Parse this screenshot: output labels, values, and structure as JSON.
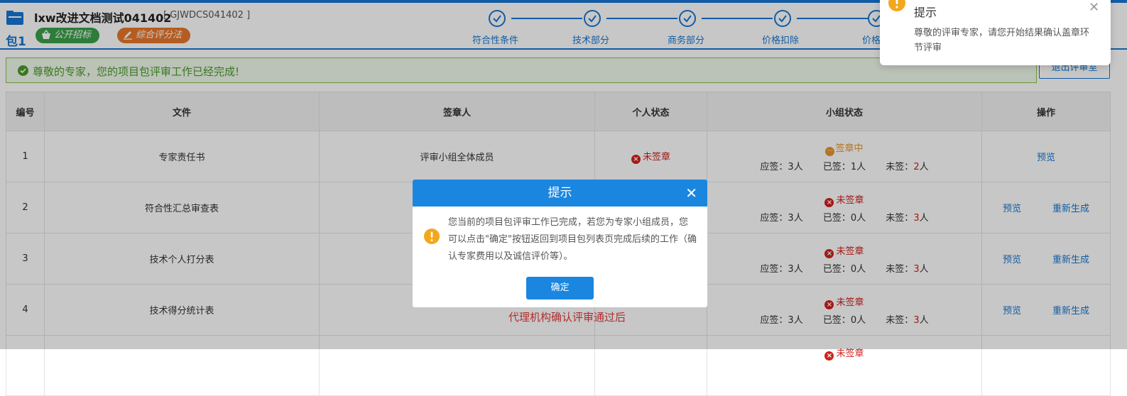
{
  "header": {
    "package_label": "包1",
    "project_title": "lxw改进文档测试041402",
    "project_code": "[ GJWDCS041402 ]",
    "tags": [
      "公开招标",
      "综合评分法"
    ],
    "steps": [
      "符合性条件",
      "技术部分",
      "商务部分",
      "价格扣除",
      "价格"
    ]
  },
  "banner": {
    "message": "尊敬的专家，您的项目包评审工作已经完成!"
  },
  "exit_button": "退出评审室",
  "table": {
    "headers": [
      "编号",
      "文件",
      "签章人",
      "个人状态",
      "小组状态",
      "操作"
    ],
    "count_labels": {
      "should": "应签：",
      "signed": "已签：",
      "unsigned": "未签：",
      "unit": "人"
    },
    "rows": [
      {
        "no": "1",
        "file": "专家责任书",
        "signer": "评审小组全体成员",
        "personal": "未签章",
        "group": "签章中",
        "should": "3",
        "signed": "1",
        "unsigned": "2",
        "actions": [
          "预览"
        ]
      },
      {
        "no": "2",
        "file": "符合性汇总审查表",
        "signer": "",
        "personal": "",
        "group": "未签章",
        "should": "3",
        "signed": "0",
        "unsigned": "3",
        "actions": [
          "预览",
          "重新生成"
        ]
      },
      {
        "no": "3",
        "file": "技术个人打分表",
        "signer": "",
        "personal": "",
        "group": "未签章",
        "should": "3",
        "signed": "0",
        "unsigned": "3",
        "actions": [
          "预览",
          "重新生成"
        ]
      },
      {
        "no": "4",
        "file": "技术得分统计表",
        "signer": "",
        "personal": "",
        "group": "未签章",
        "should": "3",
        "signed": "0",
        "unsigned": "3",
        "actions": [
          "预览",
          "重新生成"
        ]
      }
    ],
    "partial_row_status": "未签章"
  },
  "note_below_modal": "代理机构确认评审通过后",
  "toast": {
    "title": "提示",
    "message": "尊敬的评审专家，请您开始结果确认盖章环节评审"
  },
  "modal": {
    "title": "提示",
    "message": "您当前的项目包评审工作已完成，若您为专家小组成员，您可以点击\"确定\"按钮返回到项目包列表页完成后续的工作（确认专家费用以及诚信评价等）。",
    "ok_label": "确定"
  },
  "colors": {
    "primary": "#1677d2",
    "success": "#4a9b2a",
    "danger": "#d0201c",
    "warning": "#e8952b"
  }
}
